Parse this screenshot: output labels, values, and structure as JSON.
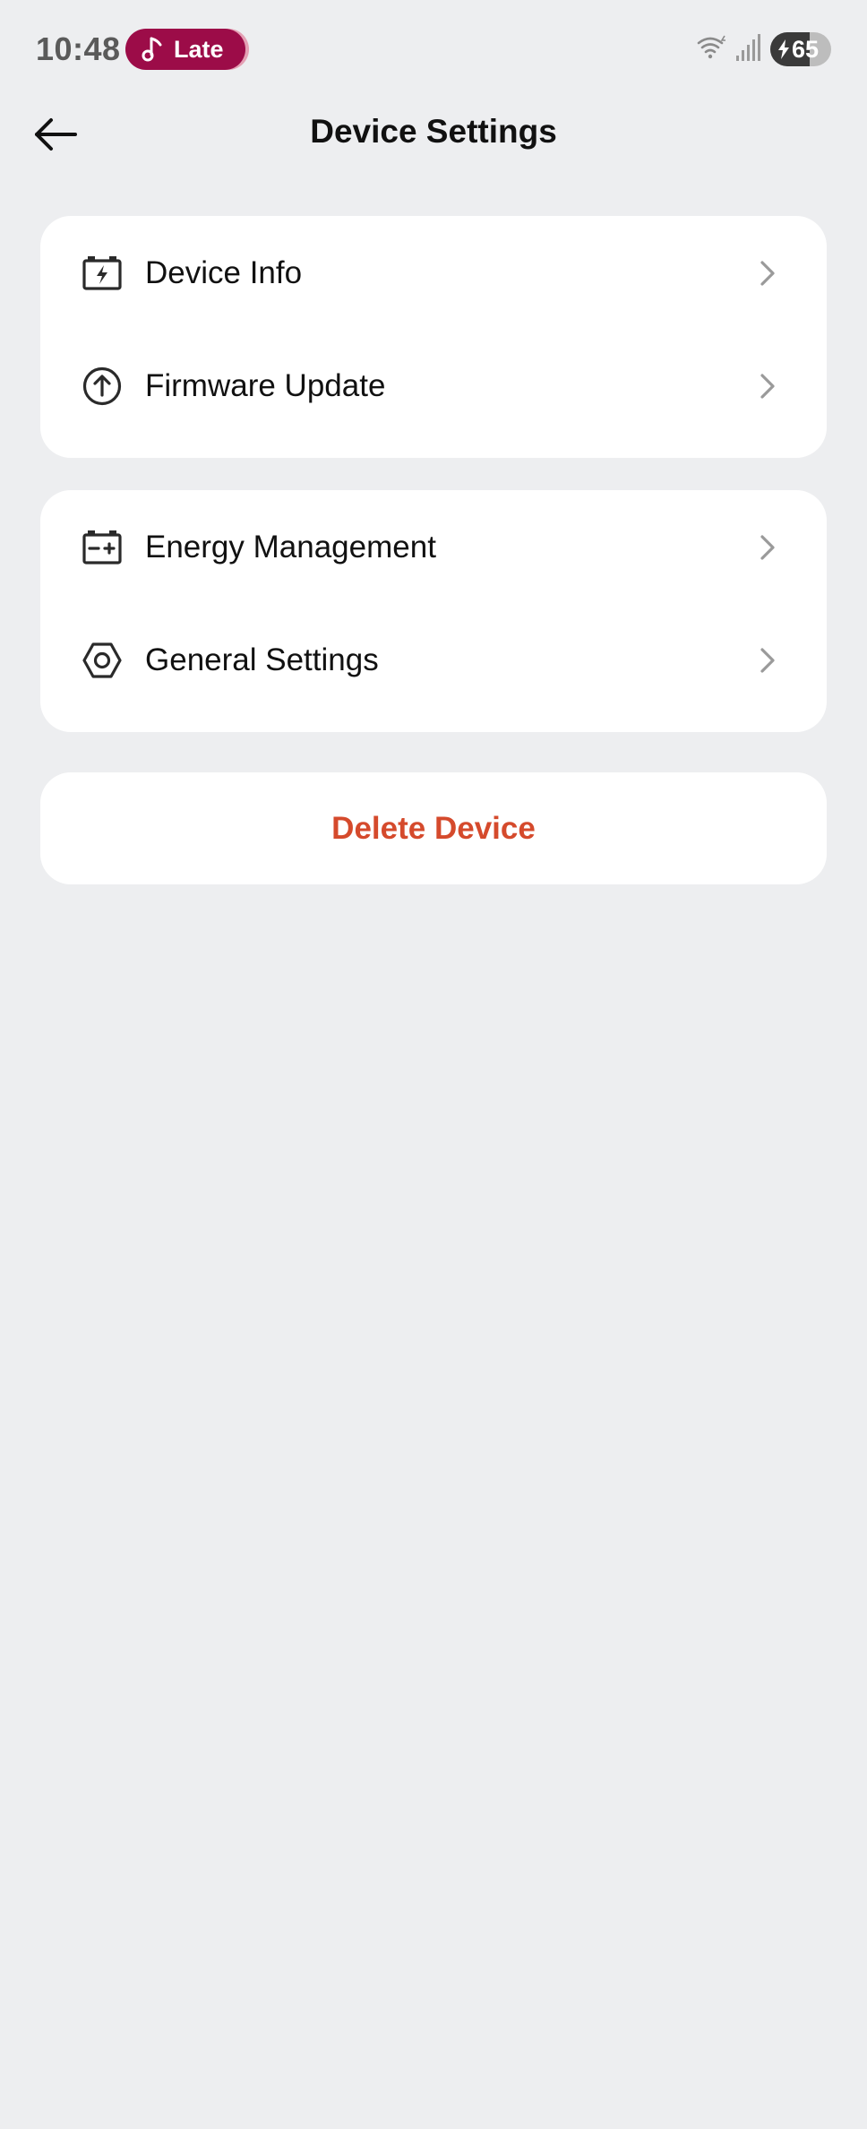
{
  "status_bar": {
    "time": "10:48",
    "media_pill_label": "Late",
    "battery_level": "65",
    "battery_fraction": 0.65,
    "icons": [
      "music-note-icon",
      "wifi-icon",
      "signal-icon",
      "battery-charging-icon"
    ]
  },
  "header": {
    "title": "Device Settings",
    "back_icon": "arrow-left-icon"
  },
  "groups": [
    {
      "items": [
        {
          "label": "Device Info",
          "icon": "battery-bolt-icon"
        },
        {
          "label": "Firmware Update",
          "icon": "circle-arrow-up-icon"
        }
      ]
    },
    {
      "items": [
        {
          "label": "Energy Management",
          "icon": "battery-plus-minus-icon"
        },
        {
          "label": "General Settings",
          "icon": "hexagon-gear-icon"
        }
      ]
    }
  ],
  "delete_button": {
    "label": "Delete Device"
  },
  "colors": {
    "background": "#edeef0",
    "card": "#ffffff",
    "media_pill": "#9c0c48",
    "danger": "#d54a2c",
    "chevron": "#9a9a9a"
  }
}
